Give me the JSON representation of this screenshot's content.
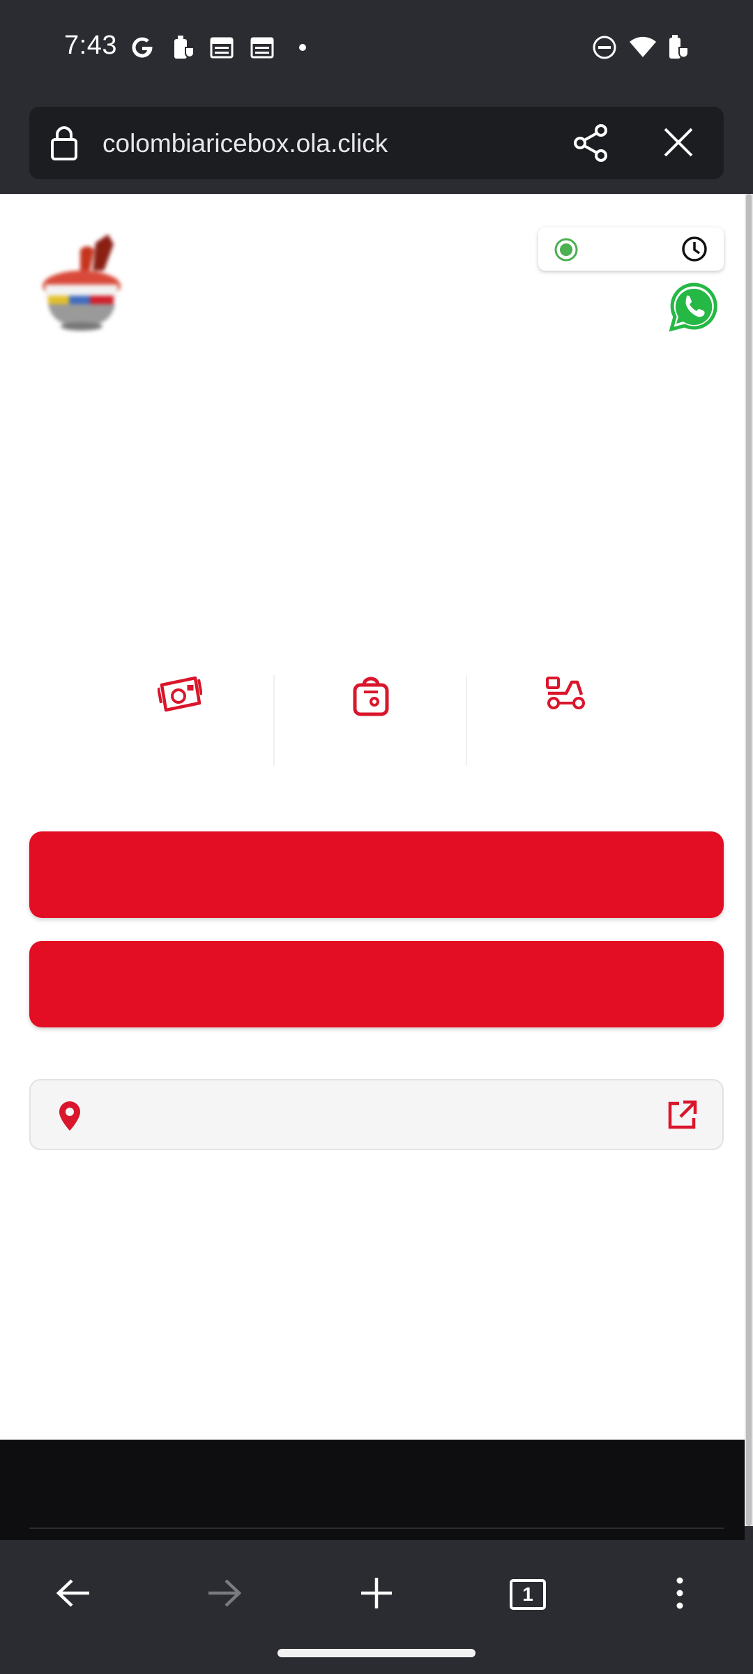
{
  "status_bar": {
    "time": "7:43",
    "icons": [
      "google-g-icon",
      "work-badge-icon",
      "calendar-icon",
      "calendar-icon",
      "notification-dot-icon",
      "do-not-disturb-icon",
      "wifi-icon",
      "battery-icon"
    ]
  },
  "url_bar": {
    "url": "colombiaricebox.ola.click",
    "icons": [
      "lock-icon",
      "share-icon",
      "close-icon"
    ]
  },
  "header": {
    "logo_icon": "restaurant-logo",
    "hours_status_color": "#4caf50",
    "icons": [
      "open-status-dot-icon",
      "clock-icon",
      "whatsapp-icon"
    ]
  },
  "services": [
    {
      "icon": "dine-in-icon"
    },
    {
      "icon": "takeaway-bag-icon"
    },
    {
      "icon": "delivery-scooter-icon"
    }
  ],
  "buttons": {
    "primary_1_label": "",
    "primary_2_label": ""
  },
  "address": {
    "text": "",
    "icons": [
      "location-pin-icon",
      "external-link-icon"
    ]
  },
  "colors": {
    "accent": "#e30d24",
    "chrome": "#2b2c31",
    "footer": "#0e0e10",
    "whatsapp": "#25b844"
  },
  "bottom_nav": {
    "items": [
      "back-arrow-icon",
      "forward-arrow-icon",
      "new-tab-icon",
      "tab-count-icon",
      "more-menu-icon"
    ],
    "tab_count": "1"
  }
}
